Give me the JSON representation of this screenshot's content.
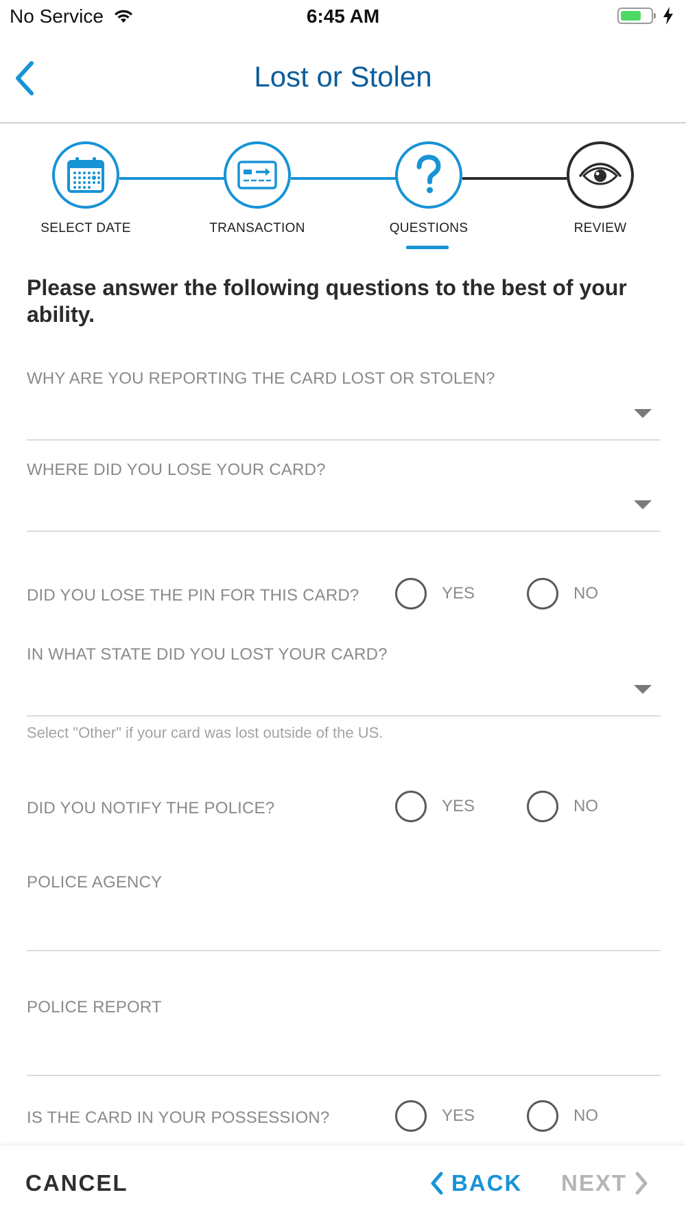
{
  "status_bar": {
    "carrier": "No Service",
    "time": "6:45 AM",
    "battery_level": 0.7,
    "battery_color": "#4cd964"
  },
  "nav": {
    "title": "Lost or Stolen",
    "back_icon": "chevron-left-icon"
  },
  "colors": {
    "accent": "#1793d6",
    "title_blue": "#0b5d9c",
    "disabled": "#b5b5b5"
  },
  "steps": [
    {
      "label": "SELECT DATE",
      "icon": "calendar-icon",
      "state": "complete"
    },
    {
      "label": "TRANSACTION",
      "icon": "card-transfer-icon",
      "state": "complete"
    },
    {
      "label": "QUESTIONS",
      "icon": "question-mark-icon",
      "state": "current"
    },
    {
      "label": "REVIEW",
      "icon": "eye-icon",
      "state": "upcoming"
    }
  ],
  "form": {
    "intro": "Please answer the following questions to the best of your ability.",
    "q_reason": "WHY ARE YOU REPORTING THE CARD LOST OR STOLEN?",
    "q_where": "WHERE DID YOU LOSE YOUR CARD?",
    "q_pin": "DID YOU LOSE THE PIN FOR THIS CARD?",
    "q_state": "IN WHAT STATE DID YOU LOST YOUR CARD?",
    "state_hint": "Select \"Other\" if your card was lost outside of the US.",
    "q_police": "DID YOU NOTIFY THE POLICE?",
    "q_agency": "POLICE AGENCY",
    "q_report": "POLICE REPORT",
    "q_possession": "IS THE CARD IN YOUR POSSESSION?",
    "yes": "YES",
    "no": "NO"
  },
  "footer": {
    "cancel": "CANCEL",
    "back": "BACK",
    "next": "NEXT"
  }
}
